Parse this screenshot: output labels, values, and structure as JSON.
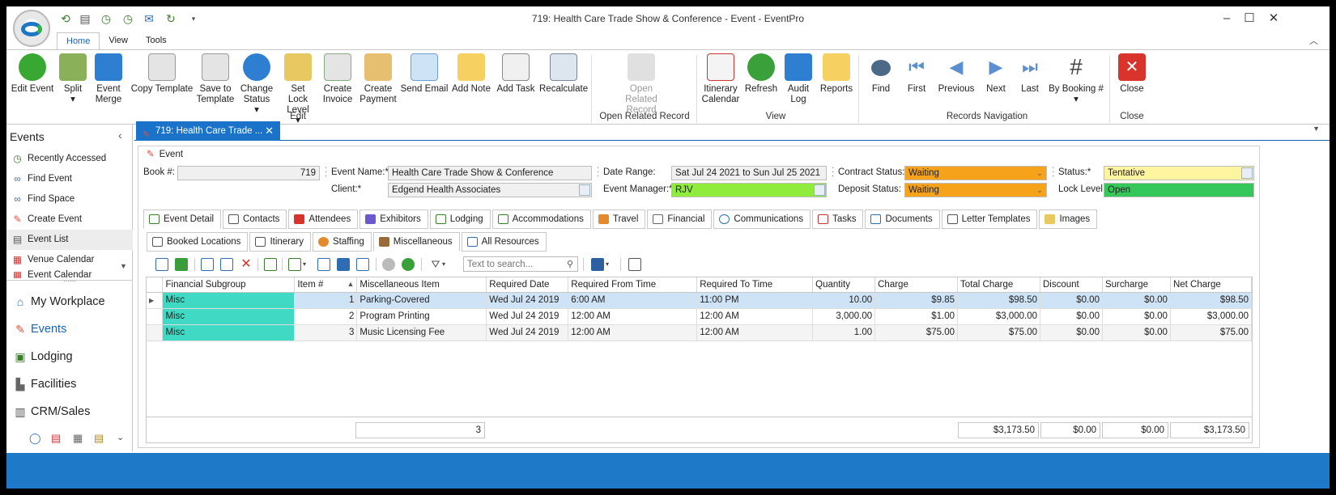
{
  "window": {
    "title": "719: Health Care Trade Show & Conference - Event - EventPro"
  },
  "ribbon_tabs": [
    "Home",
    "View",
    "Tools"
  ],
  "ribbon": {
    "buttons": [
      {
        "label": "Edit Event",
        "icon": "gear-icon"
      },
      {
        "label": "Split",
        "icon": "split-icon",
        "dropdown": true
      },
      {
        "label": "Event Merge",
        "icon": "merge-icon"
      },
      {
        "label": "Copy Template",
        "icon": "copy-template-icon"
      },
      {
        "label": "Save to Template",
        "icon": "save-template-icon"
      },
      {
        "label": "Change Status",
        "icon": "info-icon",
        "dropdown": true
      },
      {
        "label": "Set Lock Level",
        "icon": "lock-icon",
        "dropdown": true
      },
      {
        "label": "Create Invoice",
        "icon": "invoice-icon"
      },
      {
        "label": "Create Payment",
        "icon": "payment-icon"
      },
      {
        "label": "Send Email",
        "icon": "envelope-icon"
      },
      {
        "label": "Add Note",
        "icon": "note-icon"
      },
      {
        "label": "Add Task",
        "icon": "task-icon"
      },
      {
        "label": "Recalculate",
        "icon": "calculator-icon"
      },
      {
        "label": "Open Related Record",
        "icon": "related-record-icon",
        "disabled": true
      },
      {
        "label": "Itinerary Calendar",
        "icon": "calendar-icon"
      },
      {
        "label": "Refresh",
        "icon": "refresh-icon"
      },
      {
        "label": "Audit Log",
        "icon": "audit-log-icon"
      },
      {
        "label": "Reports",
        "icon": "reports-icon"
      },
      {
        "label": "Find",
        "icon": "binoculars-icon"
      },
      {
        "label": "First",
        "icon": "first-icon"
      },
      {
        "label": "Previous",
        "icon": "previous-icon"
      },
      {
        "label": "Next",
        "icon": "next-icon"
      },
      {
        "label": "Last",
        "icon": "last-icon"
      },
      {
        "label": "By Booking #",
        "icon": "hash-icon",
        "dropdown": true
      },
      {
        "label": "Close",
        "icon": "close-icon"
      }
    ],
    "groups": [
      "Edit",
      "Open Related Record",
      "View",
      "Records Navigation",
      "Close"
    ]
  },
  "nav": {
    "title": "Events",
    "items": [
      "Recently Accessed",
      "Find Event",
      "Find Space",
      "Create Event",
      "Event List",
      "Venue Calendar",
      "Event Calendar"
    ],
    "sections": [
      "My Workplace",
      "Events",
      "Lodging",
      "Facilities",
      "CRM/Sales"
    ]
  },
  "doc_tab": {
    "label": "719: Health Care Trade ..."
  },
  "event": {
    "header": "Event",
    "book_label": "Book #:",
    "book_value": "719",
    "name_label": "Event Name:*",
    "name_value": "Health Care Trade Show & Conference",
    "client_label": "Client:*",
    "client_value": "Edgend Health Associates",
    "date_label": "Date Range:",
    "date_value": "Sat Jul 24 2021 to Sun Jul 25 2021",
    "manager_label": "Event Manager:*",
    "manager_value": "RJV",
    "contract_label": "Contract Status:",
    "contract_value": "Waiting",
    "deposit_label": "Deposit Status:",
    "deposit_value": "Waiting",
    "status_label": "Status:*",
    "status_value": "Tentative",
    "lock_label": "Lock Level:",
    "lock_value": "Open"
  },
  "colors": {
    "orange": "#f7a21b",
    "green": "#8fec3c",
    "yellow": "#fff5a0",
    "lock_green": "#35c759",
    "accent": "#1a73c8"
  },
  "main_tabs": [
    "Event Detail",
    "Contacts",
    "Attendees",
    "Exhibitors",
    "Lodging",
    "Accommodations",
    "Travel",
    "Financial",
    "Communications",
    "Tasks",
    "Documents",
    "Letter Templates",
    "Images"
  ],
  "sub_tabs": [
    "Booked Locations",
    "Itinerary",
    "Staffing",
    "Miscellaneous",
    "All Resources"
  ],
  "search": {
    "placeholder": "Text to search..."
  },
  "grid": {
    "columns": [
      "Financial Subgroup",
      "Item #",
      "Miscellaneous Item",
      "Required Date",
      "Required From Time",
      "Required To Time",
      "Quantity",
      "Charge",
      "Total Charge",
      "Discount",
      "Surcharge",
      "Net Charge"
    ],
    "rows": [
      [
        "Misc",
        "1",
        "Parking-Covered",
        "Wed Jul 24 2019",
        "6:00 AM",
        "11:00 PM",
        "10.00",
        "$9.85",
        "$98.50",
        "$0.00",
        "$0.00",
        "$98.50"
      ],
      [
        "Misc",
        "2",
        "Program Printing",
        "Wed Jul 24 2019",
        "12:00 AM",
        "12:00 AM",
        "3,000.00",
        "$1.00",
        "$3,000.00",
        "$0.00",
        "$0.00",
        "$3,000.00"
      ],
      [
        "Misc",
        "3",
        "Music Licensing Fee",
        "Wed Jul 24 2019",
        "12:00 AM",
        "12:00 AM",
        "1.00",
        "$75.00",
        "$75.00",
        "$0.00",
        "$0.00",
        "$75.00"
      ]
    ],
    "footer": {
      "count": "3",
      "total_charge": "$3,173.50",
      "discount": "$0.00",
      "surcharge": "$0.00",
      "net_charge": "$3,173.50"
    }
  }
}
